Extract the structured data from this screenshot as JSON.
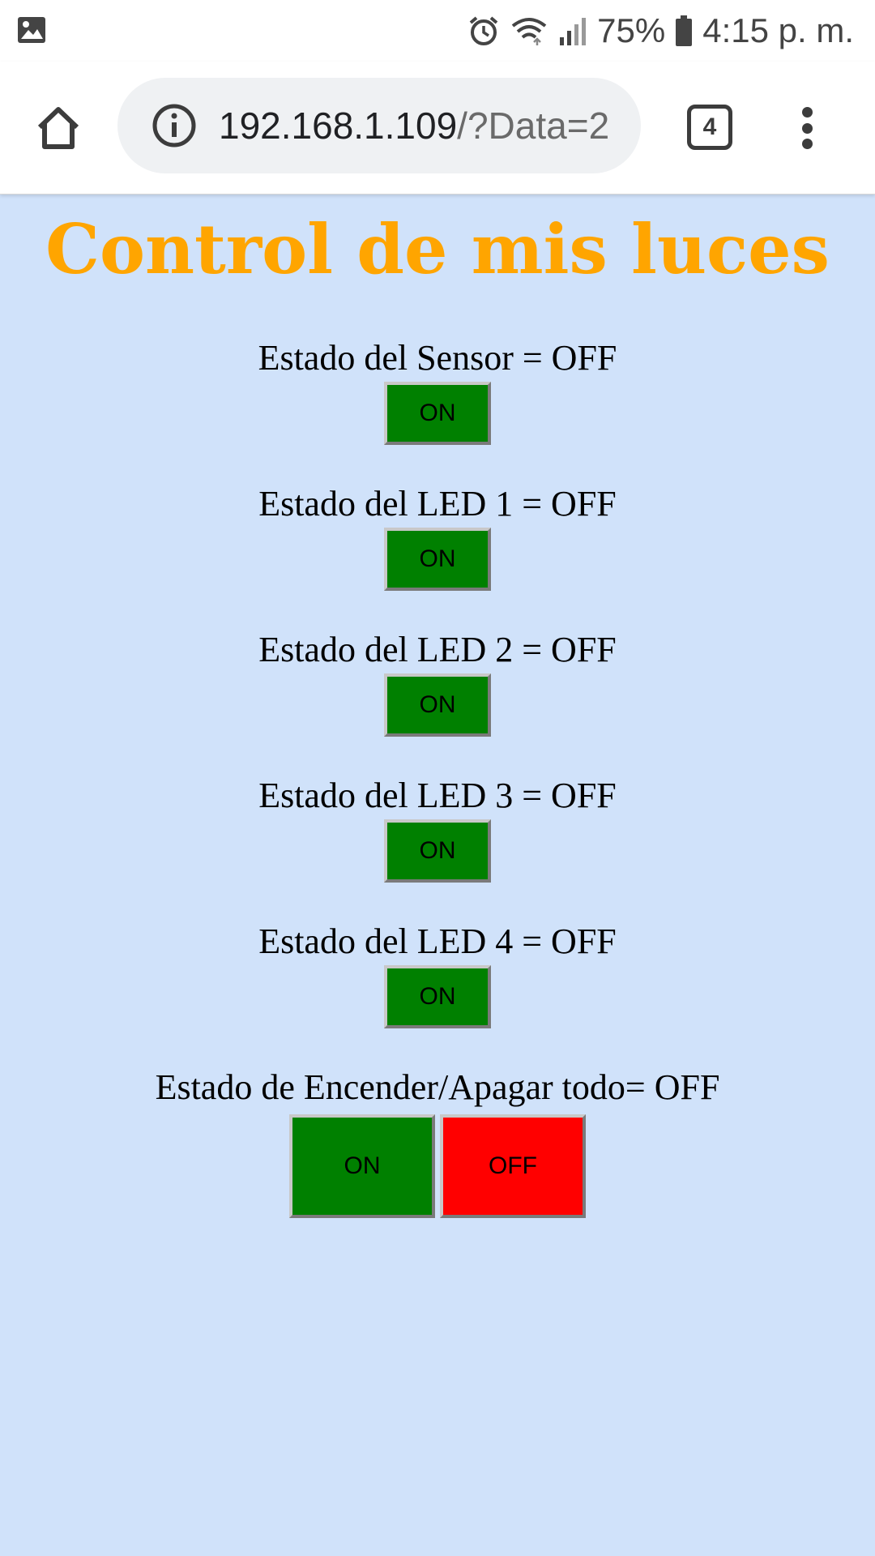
{
  "status_bar": {
    "notification_icon": "image-icon",
    "alarm_icon": "alarm-icon",
    "wifi_icon": "wifi-icon",
    "signal_icon": "signal-icon",
    "battery_percent": "75%",
    "battery_icon": "battery-icon",
    "time": "4:15 p. m."
  },
  "browser": {
    "url_host": "192.168.1.109",
    "url_path": "/?Data=2",
    "tab_count": "4",
    "home_icon": "home-icon",
    "info_icon": "info-icon",
    "menu_icon": "more-vert-icon"
  },
  "page": {
    "title": "Control de mis luces",
    "controls": [
      {
        "label": "Estado del Sensor = OFF",
        "button": "ON"
      },
      {
        "label": "Estado del LED 1 = OFF",
        "button": "ON"
      },
      {
        "label": "Estado del LED 2 = OFF",
        "button": "ON"
      },
      {
        "label": "Estado del LED 3 = OFF",
        "button": "ON"
      },
      {
        "label": "Estado del LED 4 = OFF",
        "button": "ON"
      }
    ],
    "all_control": {
      "label": "Estado de Encender/Apagar todo= OFF",
      "on_button": "ON",
      "off_button": "OFF"
    }
  },
  "colors": {
    "page_background": "#d0e2fa",
    "title": "#ffa500",
    "on_button": "#008000",
    "off_button": "#ff0000"
  }
}
